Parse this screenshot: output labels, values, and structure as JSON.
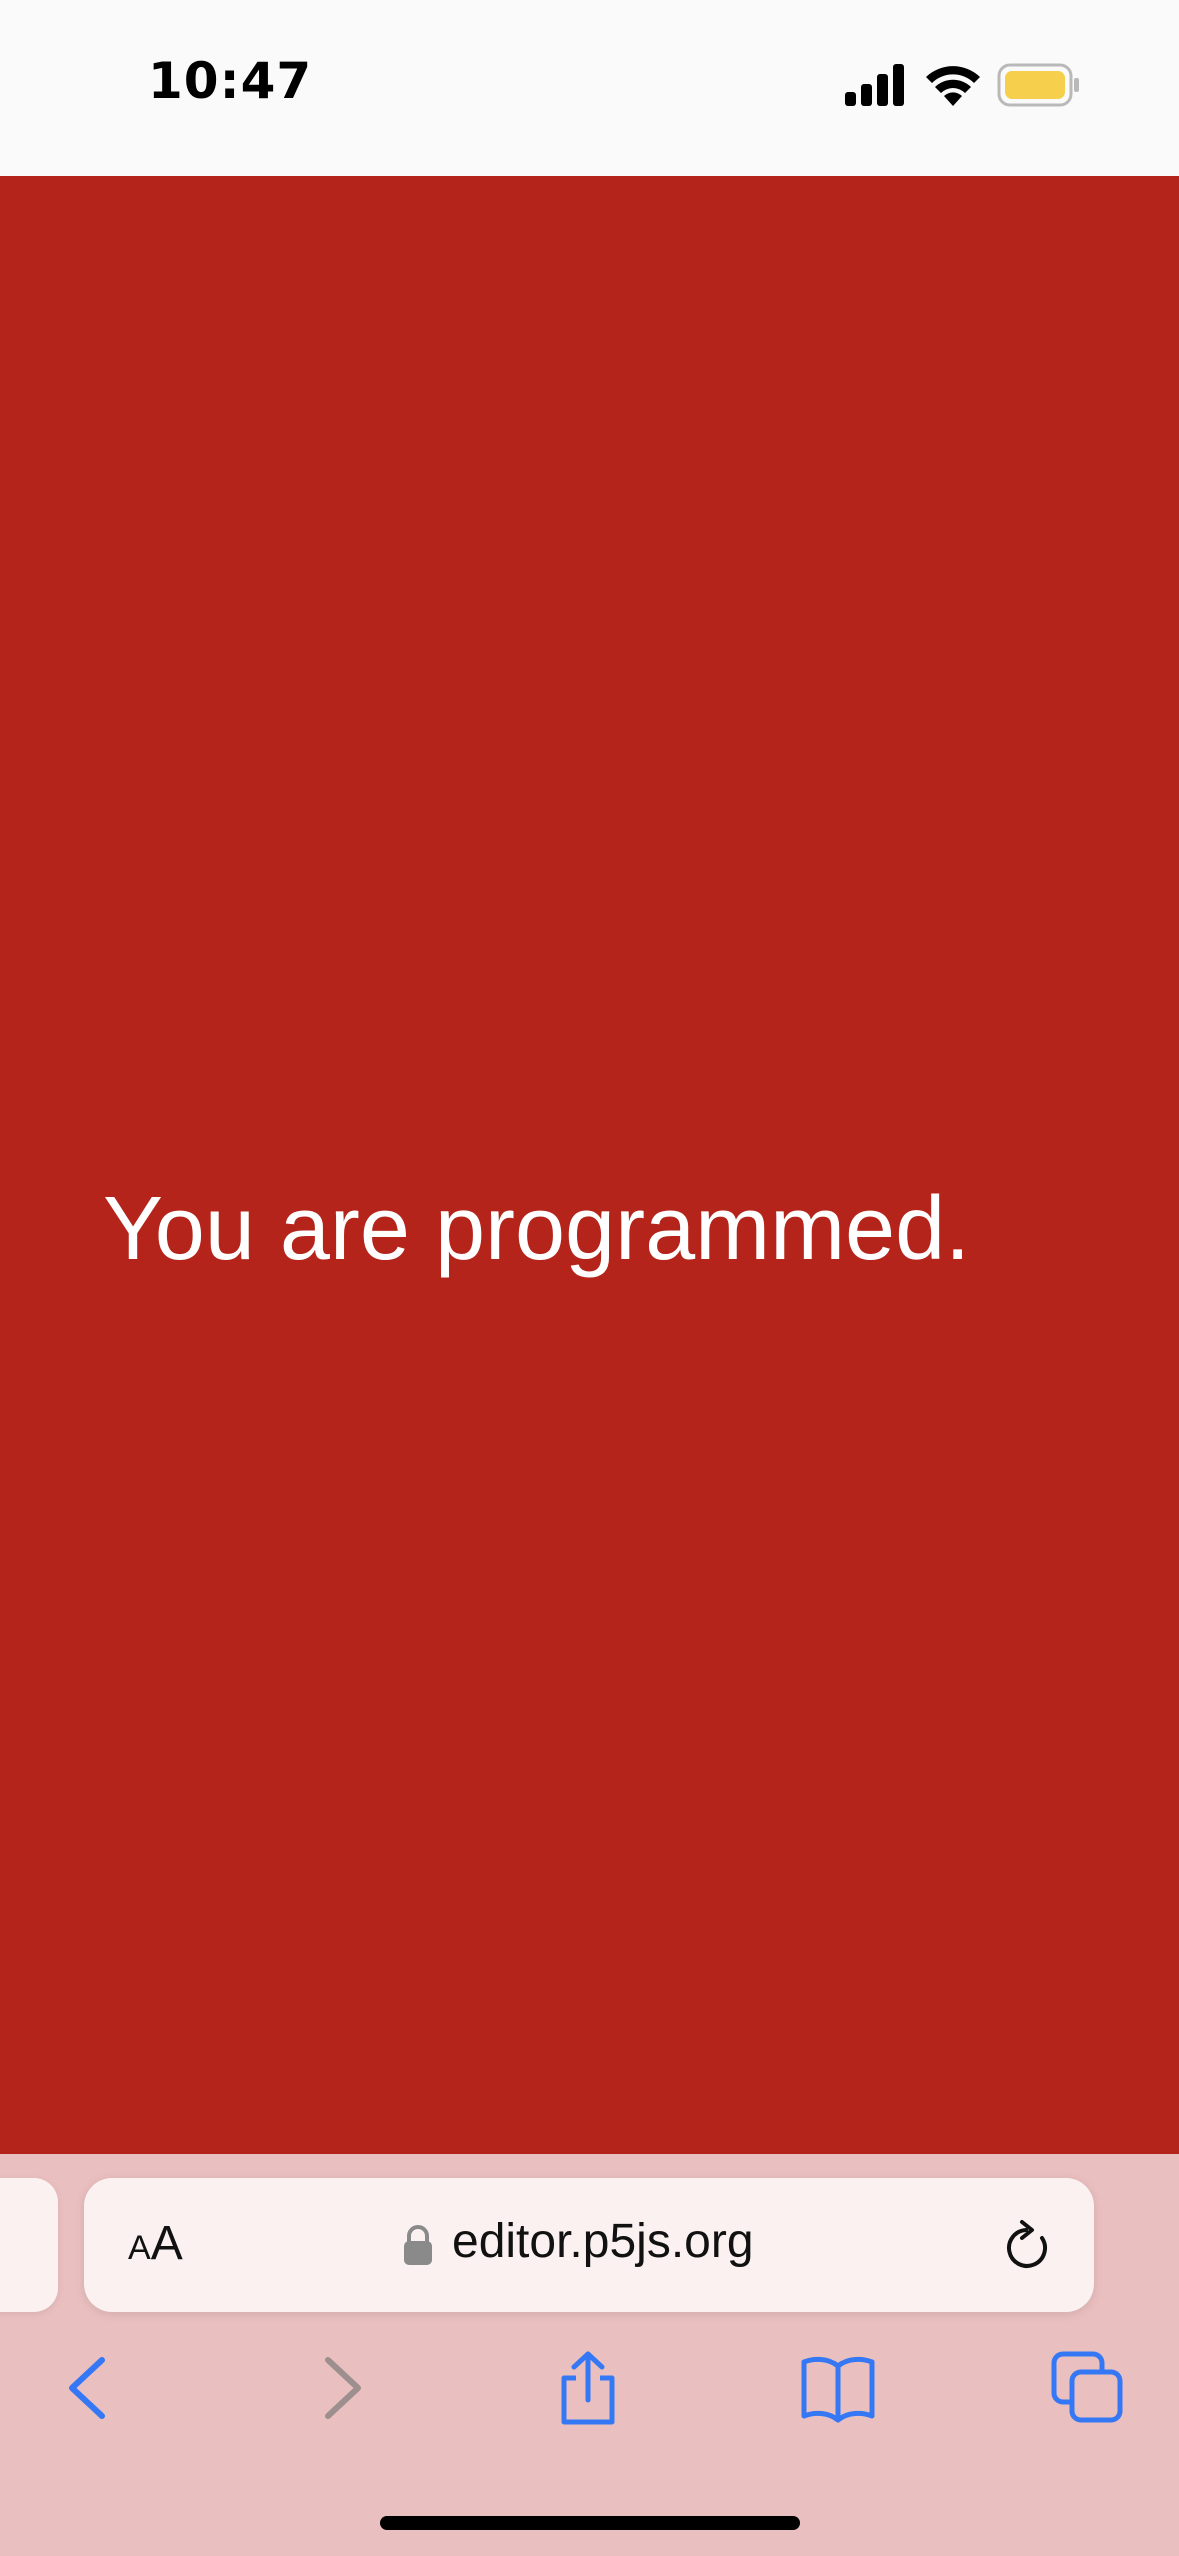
{
  "status_bar": {
    "time": "10:47",
    "icons": [
      "cellular-signal-icon",
      "wifi-icon",
      "battery-icon"
    ],
    "battery_color": "#f6cf4c"
  },
  "page": {
    "background_color": "#b4241a",
    "canvas_text": "You are programmed."
  },
  "browser": {
    "text_size_button_small": "A",
    "text_size_button_large": "A",
    "url": "editor.p5js.org",
    "accent_color": "#3478f6",
    "toolbar": [
      "back-icon",
      "forward-icon",
      "share-icon",
      "bookmarks-icon",
      "tabs-icon"
    ]
  }
}
